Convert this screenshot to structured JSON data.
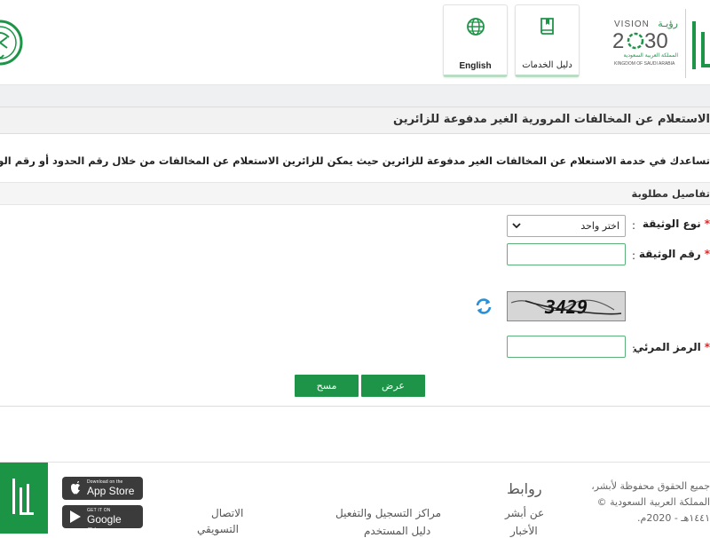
{
  "header": {
    "tiles": [
      {
        "label": "دليل الخدمات",
        "icon": "book-icon"
      },
      {
        "label": "English",
        "icon": "globe-icon"
      }
    ],
    "vision": {
      "line1": "VISION",
      "arabic": "رؤيـة",
      "year_left": "2",
      "year_right": "30",
      "sub1": "المملكة العربية السعودية",
      "sub2": "KINGDOM OF SAUDI ARABIA"
    }
  },
  "page": {
    "title": "الاستعلام عن المخالفات المرورية الغير مدفوعة للزائرين",
    "description": "تساعدك في خدمة الاستعلام عن المخالفات الغير مدفوعة للزائرين حيث يمكن للزائرين الاستعلام عن المخالفات من خلال رقم الحدود أو رقم الوثيقة",
    "section_title": "تفاصيل مطلوبة"
  },
  "form": {
    "doc_type_label": "نوع الوثيقة",
    "doc_type_value": "اختر واحد",
    "doc_number_label": "رقم الوثيقة",
    "doc_number_value": "",
    "captcha_value": "3429",
    "captcha_label": "الرمز المرئي",
    "captcha_input_value": "",
    "required_mark": "*",
    "colon": ":"
  },
  "buttons": {
    "show": "عرض",
    "clear": "مسح"
  },
  "footer": {
    "stores": [
      {
        "small": "Download on the",
        "big": "App Store",
        "icon": "apple-icon"
      },
      {
        "small": "GET IT ON",
        "big": "Google Play",
        "icon": "google-play-icon"
      }
    ],
    "links_heading": "روابط",
    "links_col1": [
      "عن أبشر",
      "الأخبار"
    ],
    "links_col2": [
      "مراكز التسجيل والتفعيل",
      "دليل المستخدم"
    ],
    "links_col3": [
      "الاتصال",
      "التسويقي"
    ],
    "copyright": [
      "جميع الحقوق محفوظة لأبشر،",
      "المملكة العربية السعودية ©",
      "١٤٤١هـ - 2020م."
    ]
  },
  "colors": {
    "brand_green": "#1e9448",
    "required_red": "#d62c2c",
    "refresh_blue": "#2a8fd6"
  }
}
